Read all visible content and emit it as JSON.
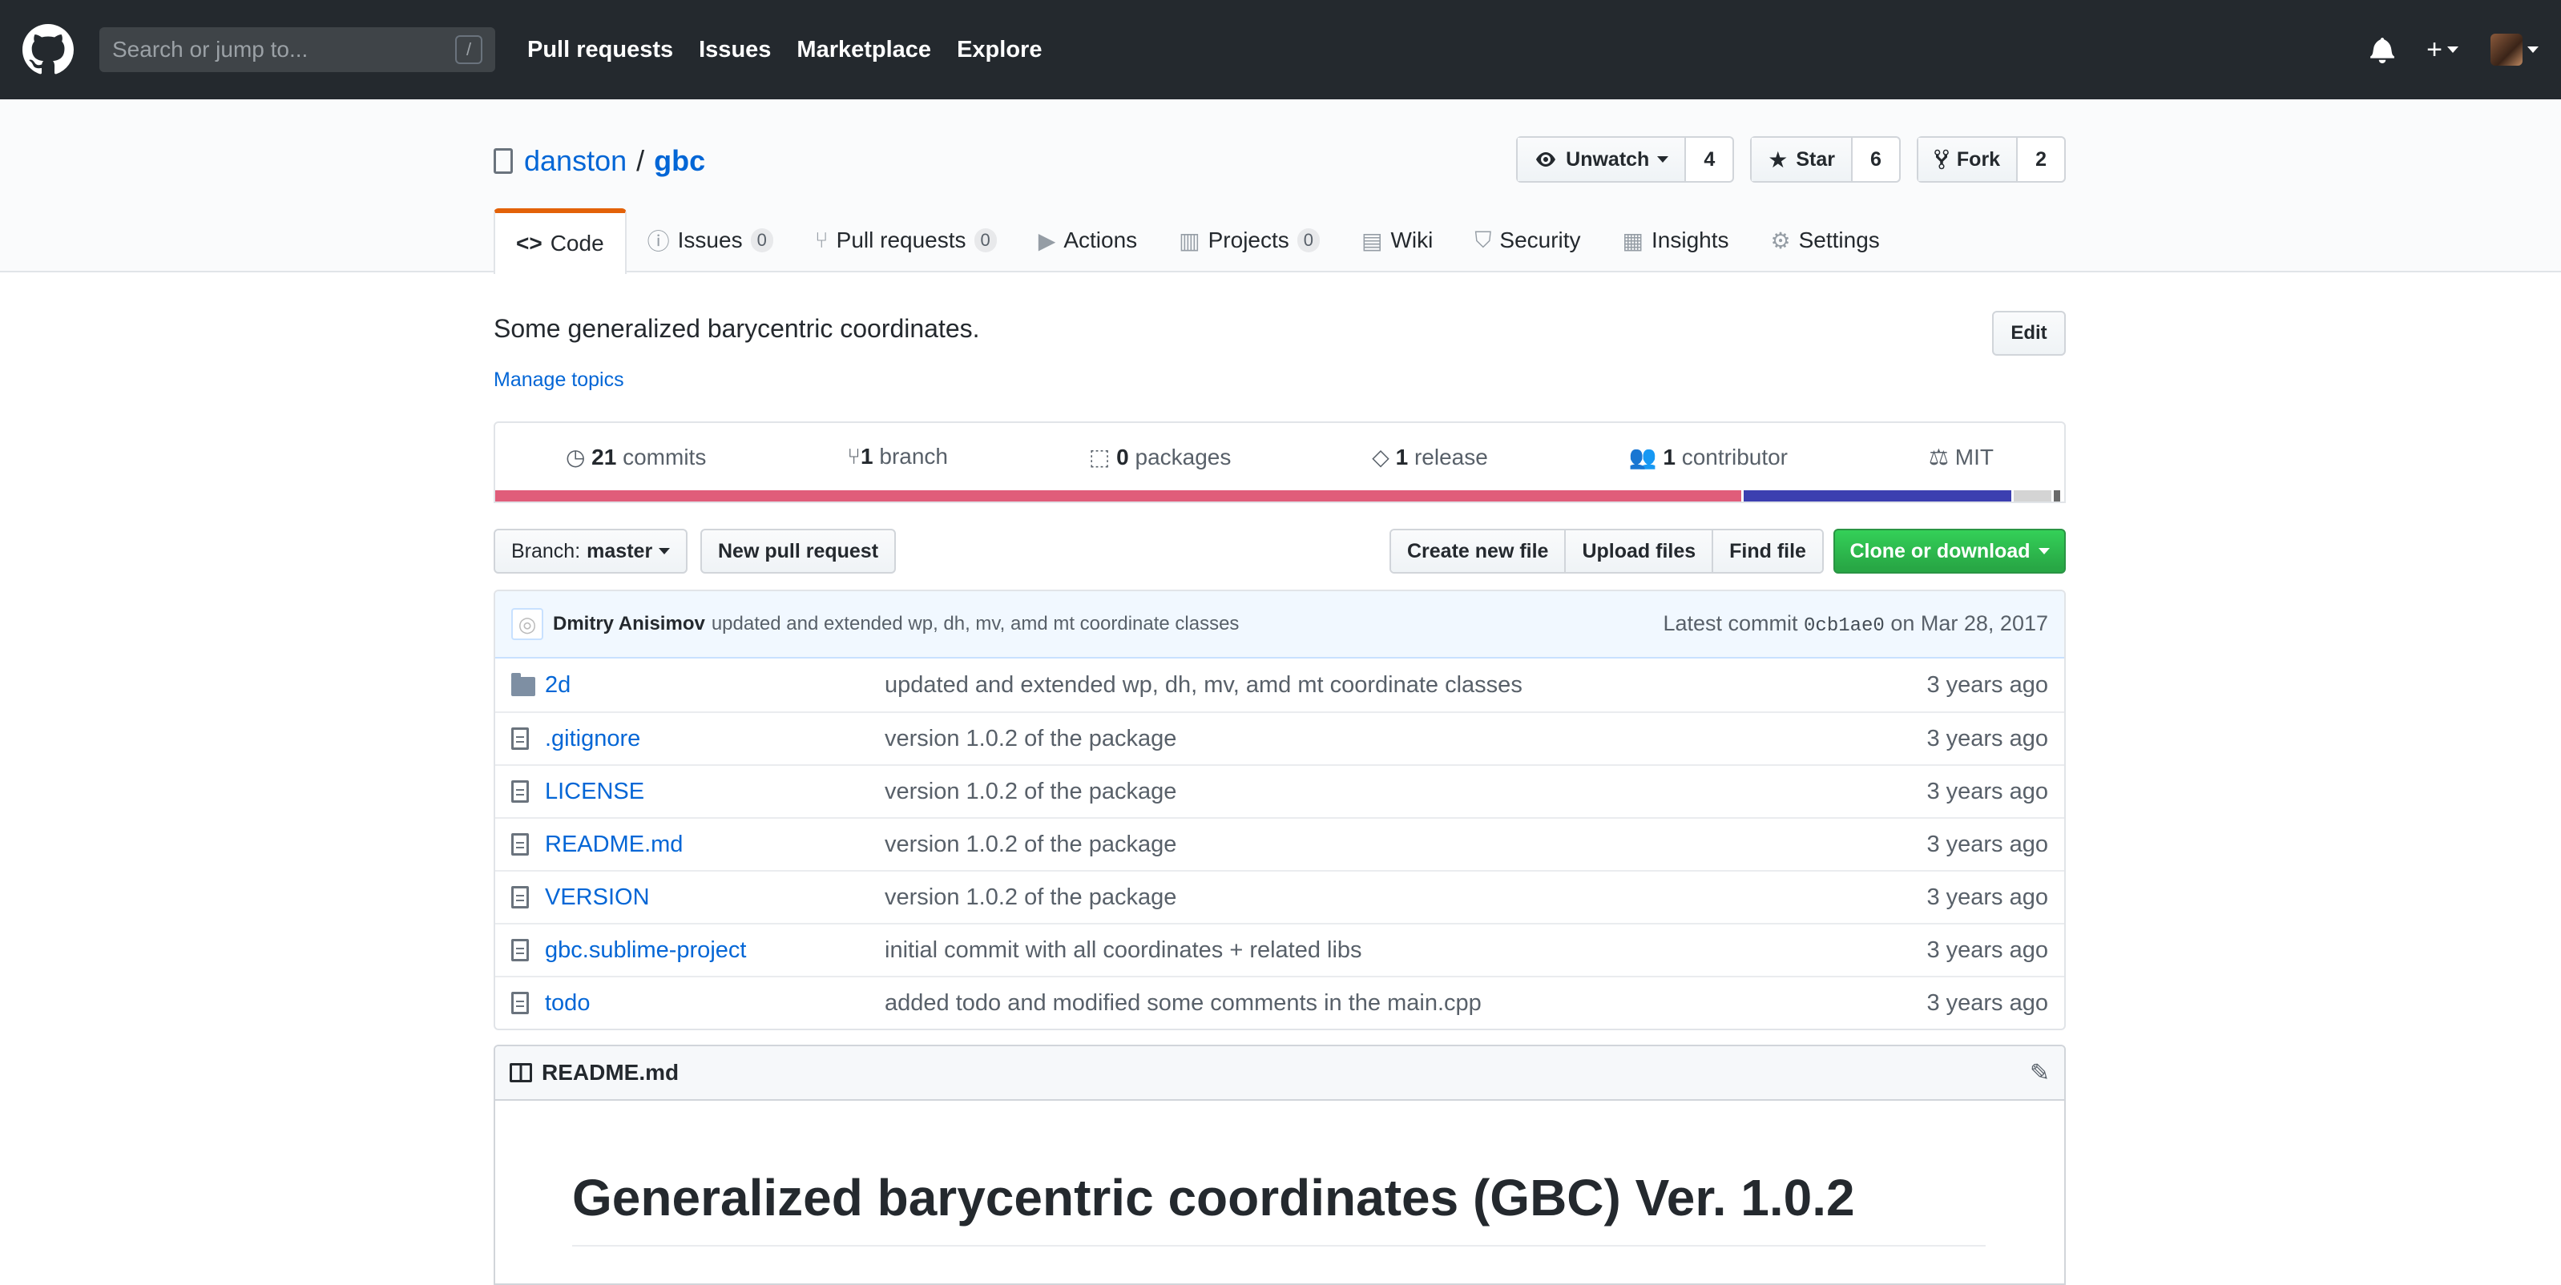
{
  "header": {
    "search_placeholder": "Search or jump to...",
    "search_key": "/",
    "nav": [
      "Pull requests",
      "Issues",
      "Marketplace",
      "Explore"
    ]
  },
  "repo": {
    "owner": "danston",
    "separator": "/",
    "name": "gbc",
    "watch": {
      "label": "Unwatch",
      "count": "4"
    },
    "star": {
      "label": "Star",
      "count": "6"
    },
    "fork": {
      "label": "Fork",
      "count": "2"
    }
  },
  "tabs": [
    {
      "label": "Code",
      "icon": "code-icon",
      "counter": ""
    },
    {
      "label": "Issues",
      "icon": "issue-icon",
      "counter": "0"
    },
    {
      "label": "Pull requests",
      "icon": "pull-request-icon",
      "counter": "0"
    },
    {
      "label": "Actions",
      "icon": "play-icon",
      "counter": ""
    },
    {
      "label": "Projects",
      "icon": "project-icon",
      "counter": "0"
    },
    {
      "label": "Wiki",
      "icon": "book-icon",
      "counter": ""
    },
    {
      "label": "Security",
      "icon": "shield-icon",
      "counter": ""
    },
    {
      "label": "Insights",
      "icon": "graph-icon",
      "counter": ""
    },
    {
      "label": "Settings",
      "icon": "gear-icon",
      "counter": ""
    }
  ],
  "description": "Some generalized barycentric coordinates.",
  "manage_topics": "Manage topics",
  "edit_label": "Edit",
  "summary": {
    "commits": {
      "count": "21",
      "label": "commits"
    },
    "branches": {
      "count": "1",
      "label": "branch"
    },
    "packages": {
      "count": "0",
      "label": "packages"
    },
    "releases": {
      "count": "1",
      "label": "release"
    },
    "contributors": {
      "count": "1",
      "label": "contributor"
    },
    "license": "MIT"
  },
  "language_bar": [
    {
      "color": "#e05d7a",
      "percent": 79.4
    },
    {
      "color": "#3c3fb0",
      "percent": 17.1
    },
    {
      "color": "#d4d4d4",
      "percent": 2.4
    },
    {
      "color": "#6a6a6a",
      "percent": 0.4
    }
  ],
  "file_nav": {
    "branch_prefix": "Branch:",
    "branch": "master",
    "new_pr": "New pull request",
    "create_file": "Create new file",
    "upload_files": "Upload files",
    "find_file": "Find file",
    "clone": "Clone or download"
  },
  "commit_tease": {
    "author": "Dmitry Anisimov",
    "message": "updated and extended wp, dh, mv, amd mt coordinate classes",
    "latest_prefix": "Latest commit",
    "sha": "0cb1ae0",
    "date_text": "on Mar 28, 2017"
  },
  "files": [
    {
      "type": "dir",
      "name": "2d",
      "message": "updated and extended wp, dh, mv, amd mt coordinate classes",
      "age": "3 years ago"
    },
    {
      "type": "file",
      "name": ".gitignore",
      "message": "version 1.0.2 of the package",
      "age": "3 years ago"
    },
    {
      "type": "file",
      "name": "LICENSE",
      "message": "version 1.0.2 of the package",
      "age": "3 years ago"
    },
    {
      "type": "file",
      "name": "README.md",
      "message": "version 1.0.2 of the package",
      "age": "3 years ago"
    },
    {
      "type": "file",
      "name": "VERSION",
      "message": "version 1.0.2 of the package",
      "age": "3 years ago"
    },
    {
      "type": "file",
      "name": "gbc.sublime-project",
      "message": "initial commit with all coordinates + related libs",
      "age": "3 years ago"
    },
    {
      "type": "file",
      "name": "todo",
      "message": "added todo and modified some comments in the main.cpp",
      "age": "3 years ago"
    }
  ],
  "readme": {
    "filename": "README.md",
    "heading": "Generalized barycentric coordinates (GBC) Ver. 1.0.2"
  }
}
